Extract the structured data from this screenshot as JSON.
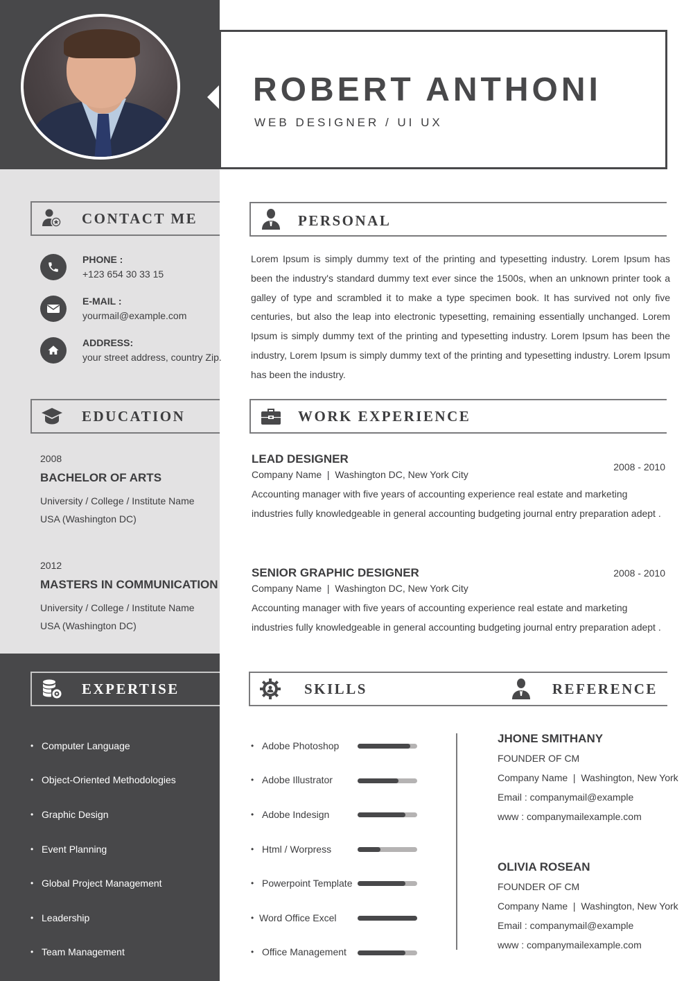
{
  "header": {
    "name": "ROBERT ANTHONI",
    "role": "WEB DESIGNER / UI UX"
  },
  "contact": {
    "title": "CONTACT ME",
    "icon": "user-star-icon",
    "items": [
      {
        "icon": "phone-icon",
        "label": "PHONE :",
        "value": "+123 654 30 33 15"
      },
      {
        "icon": "mail-icon",
        "label": "E-MAIL :",
        "value": "yourmail@example.com"
      },
      {
        "icon": "home-icon",
        "label": "ADDRESS:",
        "value": "your street address, country Zip."
      }
    ]
  },
  "education": {
    "title": "EDUCATION",
    "icon": "graduation-cap-icon",
    "items": [
      {
        "year": "2008",
        "degree": "BACHELOR OF ARTS",
        "institution": "University / College / Institute Name",
        "location": "USA (Washington DC)"
      },
      {
        "year": "2012",
        "degree": "MASTERS IN COMMUNICATION",
        "institution": "University / College / Institute Name",
        "location": "USA (Washington DC)"
      }
    ]
  },
  "expertise": {
    "title": "EXPERTISE",
    "icon": "database-gear-icon",
    "items": [
      "Computer Language",
      "Object-Oriented Methodologies",
      "Graphic Design",
      "Event Planning",
      "Global Project Management",
      "Leadership",
      "Team Management"
    ]
  },
  "personal": {
    "title": "PERSONAL",
    "icon": "person-icon",
    "text": "Lorem Ipsum is simply dummy text of the printing and typesetting industry. Lorem Ipsum has been the industry's standard dummy text ever since the 1500s, when an unknown printer took a galley of type and scrambled it to make a type specimen book. It has survived not only five centuries, but also the leap into electronic typesetting, remaining essentially unchanged. Lorem Ipsum is simply dummy text of the printing and typesetting industry. Lorem Ipsum has been the industry, Lorem Ipsum is simply dummy text of the printing and typesetting industry. Lorem Ipsum has been the industry."
  },
  "work": {
    "title": "WORK EXPERIENCE",
    "icon": "briefcase-icon",
    "jobs": [
      {
        "title": "LEAD DESIGNER",
        "dates": "2008 - 2010",
        "company": "Company Name  |  Washington DC, New York City",
        "description": "Accounting manager with five years of accounting experience real estate and marketing industries fully knowledgeable in general accounting budgeting journal entry preparation adept ."
      },
      {
        "title": "SENIOR GRAPHIC DESIGNER",
        "dates": "2008 - 2010",
        "company": "Company Name  |  Washington DC, New York City",
        "description": "Accounting manager with five years of accounting experience real estate and marketing industries fully knowledgeable in general accounting budgeting journal entry preparation adept ."
      }
    ]
  },
  "skills": {
    "title": "SKILLS",
    "icon": "gear-person-icon",
    "items": [
      {
        "name": "Adobe Photoshop",
        "level": 0.88
      },
      {
        "name": "Adobe Illustrator",
        "level": 0.69
      },
      {
        "name": "Adobe Indesign",
        "level": 0.8
      },
      {
        "name": "Html / Worpress",
        "level": 0.38
      },
      {
        "name": "Powerpoint Template",
        "level": 0.8
      },
      {
        "name": "Word Office Excel",
        "level": 1.0
      },
      {
        "name": "Office Management",
        "level": 0.8
      }
    ]
  },
  "reference": {
    "title": "REFERENCE",
    "icon": "person-icon",
    "items": [
      {
        "name": "JHONE SMITHANY",
        "position": "FOUNDER OF CM",
        "company": "Company Name  |  Washington, New York",
        "email": "Email : companymail@example",
        "web": "www : companymailexample.com"
      },
      {
        "name": "OLIVIA ROSEAN",
        "position": "FOUNDER OF CM",
        "company": "Company Name  |  Washington, New York",
        "email": "Email : companymail@example",
        "web": "www : companymailexample.com"
      }
    ]
  },
  "colors": {
    "dark": "#48484a",
    "light_panel": "#e3e2e3",
    "text": "#3d3d3f",
    "bar_track": "#b5b3b3"
  }
}
